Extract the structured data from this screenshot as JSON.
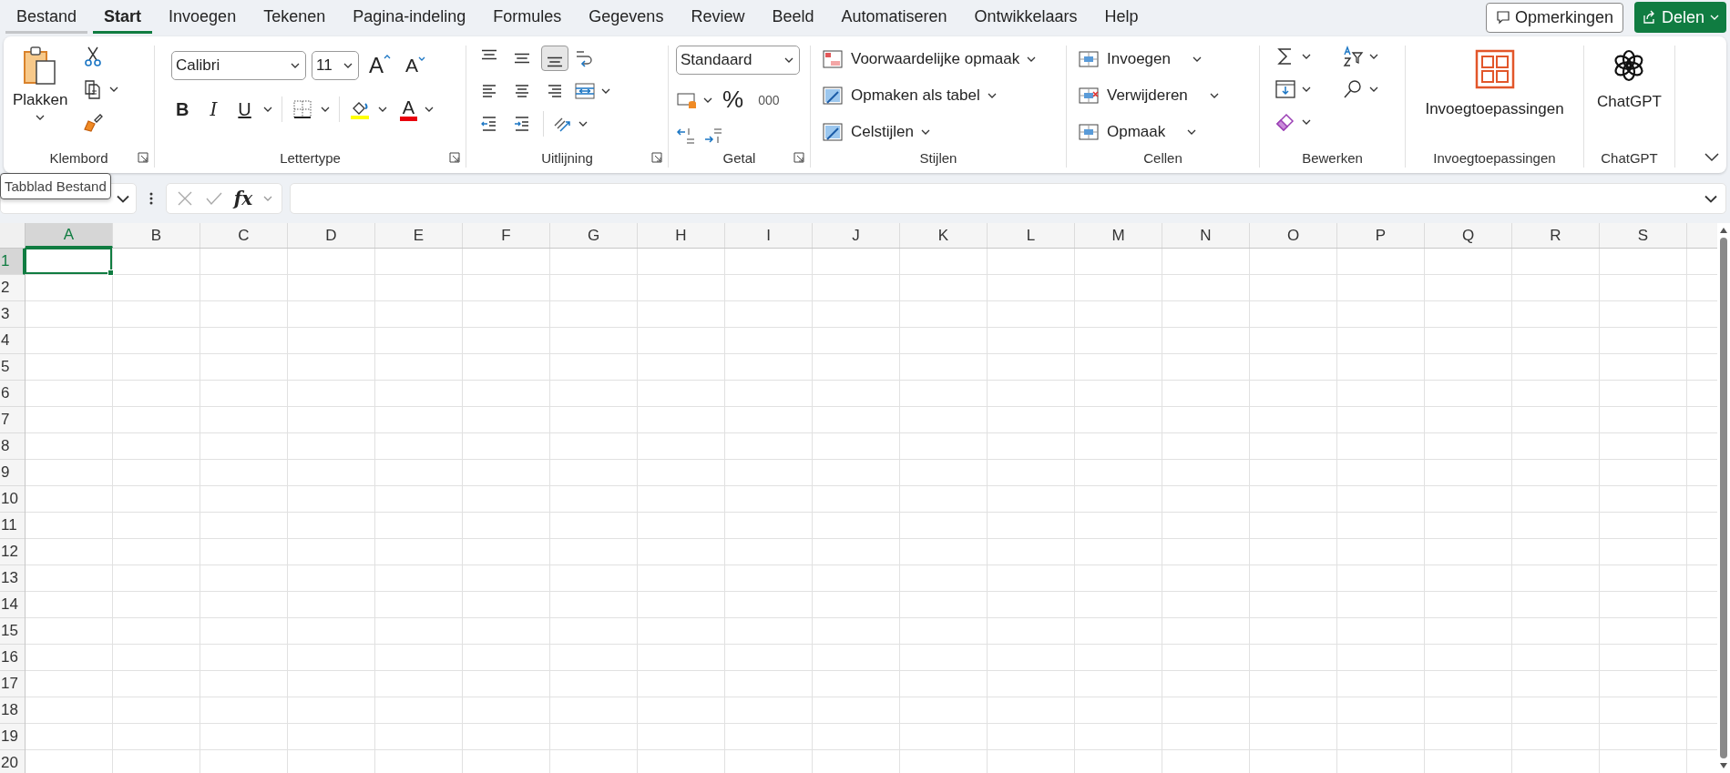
{
  "tabs": [
    {
      "label": "Bestand",
      "selected": false,
      "hovered": true
    },
    {
      "label": "Start",
      "selected": true,
      "hovered": false
    },
    {
      "label": "Invoegen",
      "selected": false,
      "hovered": false
    },
    {
      "label": "Tekenen",
      "selected": false,
      "hovered": false
    },
    {
      "label": "Pagina-indeling",
      "selected": false,
      "hovered": false
    },
    {
      "label": "Formules",
      "selected": false,
      "hovered": false
    },
    {
      "label": "Gegevens",
      "selected": false,
      "hovered": false
    },
    {
      "label": "Review",
      "selected": false,
      "hovered": false
    },
    {
      "label": "Beeld",
      "selected": false,
      "hovered": false
    },
    {
      "label": "Automatiseren",
      "selected": false,
      "hovered": false
    },
    {
      "label": "Ontwikkelaars",
      "selected": false,
      "hovered": false
    },
    {
      "label": "Help",
      "selected": false,
      "hovered": false
    }
  ],
  "actions": {
    "comments": "Opmerkingen",
    "share": "Delen"
  },
  "ribbon": {
    "clipboard": {
      "paste": "Plakken",
      "label": "Klembord"
    },
    "font": {
      "name": "Calibri",
      "size": "11",
      "grow": "A",
      "shrink": "A",
      "bold": "B",
      "italic": "I",
      "underline": "U",
      "font_color": "A",
      "label": "Lettertype"
    },
    "alignment": {
      "vertical": [
        {
          "selected": false
        },
        {
          "selected": false
        },
        {
          "selected": true
        }
      ],
      "label": "Uitlijning"
    },
    "number": {
      "format": "Standaard",
      "percent": "%",
      "thousands": "000",
      "label": "Getal"
    },
    "styles": {
      "items": [
        "Voorwaardelijke opmaak",
        "Opmaken als tabel",
        "Celstijlen"
      ],
      "label": "Stijlen"
    },
    "cells": {
      "items": [
        "Invoegen",
        "Verwijderen",
        "Opmaak"
      ],
      "label": "Cellen"
    },
    "editing": {
      "label": "Bewerken"
    },
    "addins": {
      "button": "Invoegtoepassingen",
      "label": "Invoegtoepassingen"
    },
    "chatgpt": {
      "button": "ChatGPT",
      "label": "ChatGPT"
    }
  },
  "tooltip": "Tabblad Bestand",
  "formula_bar": {
    "function_symbol": "fx"
  },
  "sheet": {
    "columns": [
      {
        "label": "A",
        "selected": true
      },
      {
        "label": "B",
        "selected": false
      },
      {
        "label": "C",
        "selected": false
      },
      {
        "label": "D",
        "selected": false
      },
      {
        "label": "E",
        "selected": false
      },
      {
        "label": "F",
        "selected": false
      },
      {
        "label": "G",
        "selected": false
      },
      {
        "label": "H",
        "selected": false
      },
      {
        "label": "I",
        "selected": false
      },
      {
        "label": "J",
        "selected": false
      },
      {
        "label": "K",
        "selected": false
      },
      {
        "label": "L",
        "selected": false
      },
      {
        "label": "M",
        "selected": false
      },
      {
        "label": "N",
        "selected": false
      },
      {
        "label": "O",
        "selected": false
      },
      {
        "label": "P",
        "selected": false
      },
      {
        "label": "Q",
        "selected": false
      },
      {
        "label": "R",
        "selected": false
      },
      {
        "label": "S",
        "selected": false
      }
    ],
    "rows": [
      {
        "label": "1",
        "selected": true
      },
      {
        "label": "2",
        "selected": false
      },
      {
        "label": "3",
        "selected": false
      },
      {
        "label": "4",
        "selected": false
      },
      {
        "label": "5",
        "selected": false
      },
      {
        "label": "6",
        "selected": false
      },
      {
        "label": "7",
        "selected": false
      },
      {
        "label": "8",
        "selected": false
      },
      {
        "label": "9",
        "selected": false
      },
      {
        "label": "10",
        "selected": false
      },
      {
        "label": "11",
        "selected": false
      },
      {
        "label": "12",
        "selected": false
      },
      {
        "label": "13",
        "selected": false
      },
      {
        "label": "14",
        "selected": false
      },
      {
        "label": "15",
        "selected": false
      },
      {
        "label": "16",
        "selected": false
      },
      {
        "label": "17",
        "selected": false
      },
      {
        "label": "18",
        "selected": false
      },
      {
        "label": "19",
        "selected": false
      },
      {
        "label": "20",
        "selected": false
      }
    ]
  }
}
